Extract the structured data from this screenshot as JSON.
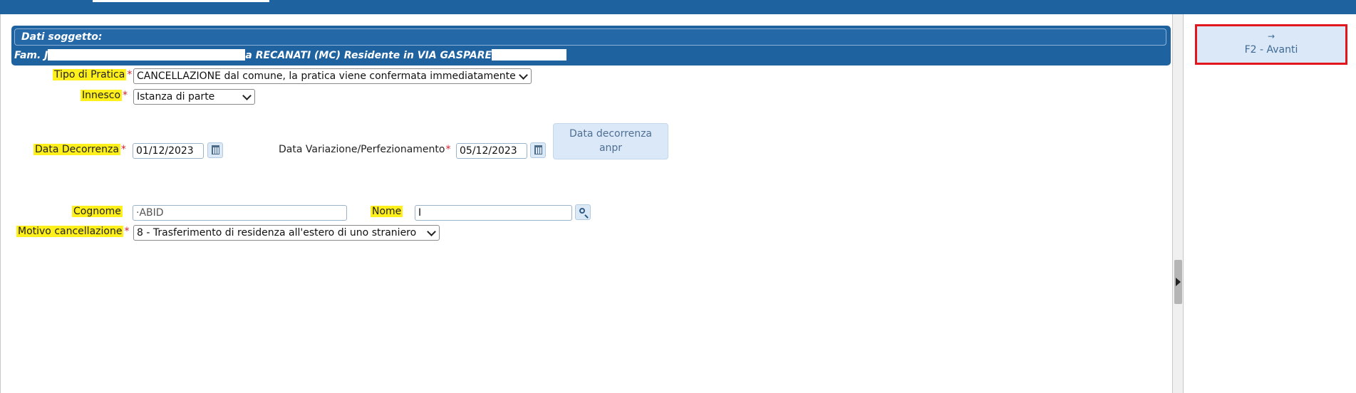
{
  "subject": {
    "title": "Dati soggetto:",
    "info_prefix": "Fam. J",
    "info_middle": "a RECANATI (MC) Residente in VIA GASPARE",
    "info_suffix": "..."
  },
  "form": {
    "tipo_pratica": {
      "label": "Tipo di Pratica",
      "required": "*",
      "value": "CANCELLAZIONE dal comune, la pratica viene confermata immediatamente"
    },
    "innesco": {
      "label": "Innesco",
      "required": "*",
      "value": "Istanza di parte"
    },
    "data_decorrenza": {
      "label": "Data Decorrenza",
      "required": "*",
      "value": "01/12/2023"
    },
    "data_variazione": {
      "label": "Data Variazione/Perfezionamento",
      "required": "*",
      "value": "05/12/2023"
    },
    "data_decorrenza_anpr": {
      "label_line1": "Data decorrenza",
      "label_line2": "anpr"
    },
    "cognome": {
      "label": "Cognome",
      "value": "·ABID"
    },
    "nome": {
      "label": "Nome",
      "value": "I"
    },
    "motivo": {
      "label": "Motivo cancellazione",
      "required": "*",
      "value": "8 - Trasferimento di residenza all'estero di uno straniero"
    }
  },
  "actions": {
    "avanti_arrow": "→",
    "avanti_label": "F2 - Avanti"
  },
  "colors": {
    "brand": "#1f62a0",
    "highlight": "#ffef1a",
    "required": "#d9212b",
    "focus_border": "#e2171d"
  }
}
